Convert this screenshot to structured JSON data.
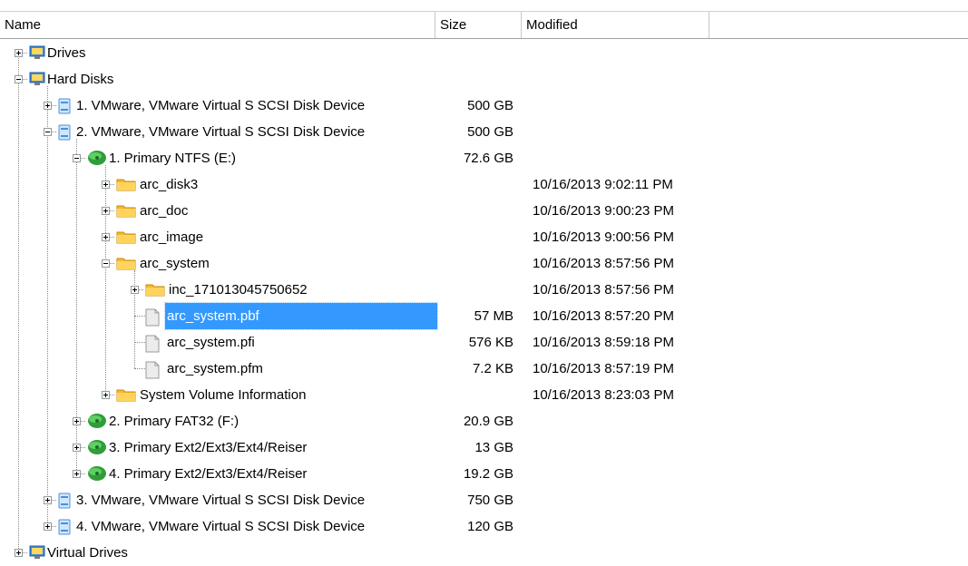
{
  "columns": {
    "name": "Name",
    "size": "Size",
    "modified": "Modified"
  },
  "rows": [
    {
      "depth": 0,
      "exp": "plus",
      "icon": "drives-icon",
      "label": "Drives",
      "size": "",
      "modified": ""
    },
    {
      "depth": 0,
      "exp": "minus",
      "icon": "drives-icon",
      "label": "Hard Disks",
      "size": "",
      "modified": ""
    },
    {
      "depth": 1,
      "exp": "plus",
      "icon": "disk-icon",
      "label": "1. VMware, VMware Virtual S SCSI Disk Device",
      "size": "500 GB",
      "modified": ""
    },
    {
      "depth": 1,
      "exp": "minus",
      "icon": "disk-icon",
      "label": "2. VMware, VMware Virtual S SCSI Disk Device",
      "size": "500 GB",
      "modified": ""
    },
    {
      "depth": 2,
      "exp": "minus",
      "icon": "partition-icon",
      "label": "1. Primary NTFS (E:)",
      "size": "72.6 GB",
      "modified": ""
    },
    {
      "depth": 3,
      "exp": "plus",
      "icon": "folder-icon",
      "label": "arc_disk3",
      "size": "",
      "modified": "10/16/2013 9:02:11 PM"
    },
    {
      "depth": 3,
      "exp": "plus",
      "icon": "folder-icon",
      "label": "arc_doc",
      "size": "",
      "modified": "10/16/2013 9:00:23 PM"
    },
    {
      "depth": 3,
      "exp": "plus",
      "icon": "folder-icon",
      "label": "arc_image",
      "size": "",
      "modified": "10/16/2013 9:00:56 PM"
    },
    {
      "depth": 3,
      "exp": "minus",
      "icon": "folder-icon",
      "label": "arc_system",
      "size": "",
      "modified": "10/16/2013 8:57:56 PM"
    },
    {
      "depth": 4,
      "exp": "plus",
      "icon": "folder-icon",
      "label": "inc_171013045750652",
      "size": "",
      "modified": "10/16/2013 8:57:56 PM"
    },
    {
      "depth": 4,
      "exp": "none",
      "icon": "file-icon",
      "label": "arc_system.pbf",
      "size": "57 MB",
      "modified": "10/16/2013 8:57:20 PM",
      "selected": true
    },
    {
      "depth": 4,
      "exp": "none",
      "icon": "file-icon",
      "label": "arc_system.pfi",
      "size": "576 KB",
      "modified": "10/16/2013 8:59:18 PM"
    },
    {
      "depth": 4,
      "exp": "none",
      "icon": "file-icon",
      "label": "arc_system.pfm",
      "size": "7.2 KB",
      "modified": "10/16/2013 8:57:19 PM"
    },
    {
      "depth": 3,
      "exp": "plus",
      "icon": "folder-icon",
      "label": "System Volume Information",
      "size": "",
      "modified": "10/16/2013 8:23:03 PM"
    },
    {
      "depth": 2,
      "exp": "plus",
      "icon": "partition-icon",
      "label": "2. Primary FAT32 (F:)",
      "size": "20.9 GB",
      "modified": ""
    },
    {
      "depth": 2,
      "exp": "plus",
      "icon": "partition-icon",
      "label": "3. Primary Ext2/Ext3/Ext4/Reiser",
      "size": "13 GB",
      "modified": ""
    },
    {
      "depth": 2,
      "exp": "plus",
      "icon": "partition-icon",
      "label": "4. Primary Ext2/Ext3/Ext4/Reiser",
      "size": "19.2 GB",
      "modified": ""
    },
    {
      "depth": 1,
      "exp": "plus",
      "icon": "disk-icon",
      "label": "3. VMware, VMware Virtual S SCSI Disk Device",
      "size": "750 GB",
      "modified": ""
    },
    {
      "depth": 1,
      "exp": "plus",
      "icon": "disk-icon",
      "label": "4. VMware, VMware Virtual S SCSI Disk Device",
      "size": "120 GB",
      "modified": ""
    },
    {
      "depth": 0,
      "exp": "plus",
      "icon": "drives-icon",
      "label": "Virtual Drives",
      "size": "",
      "modified": ""
    }
  ],
  "colors": {
    "selection": "#3399ff",
    "folder": "#f5b82e",
    "partition": "#2f9e3a",
    "disk": "#4a90d9"
  }
}
